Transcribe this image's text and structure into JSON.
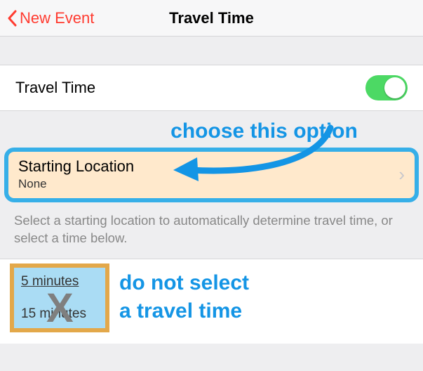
{
  "nav": {
    "back_label": "New Event",
    "title": "Travel Time"
  },
  "travel_time": {
    "label": "Travel Time",
    "enabled": true
  },
  "annotation_choose": "choose this option",
  "starting_location": {
    "label": "Starting Location",
    "value": "None"
  },
  "helper_text": "Select a starting location to automatically determine travel time, or select a time below.",
  "options": {
    "five": "5 minutes",
    "fifteen": "15 minutes"
  },
  "annotation_no_select_line1": "do not select",
  "annotation_no_select_line2": "a travel time",
  "x_mark": "X"
}
